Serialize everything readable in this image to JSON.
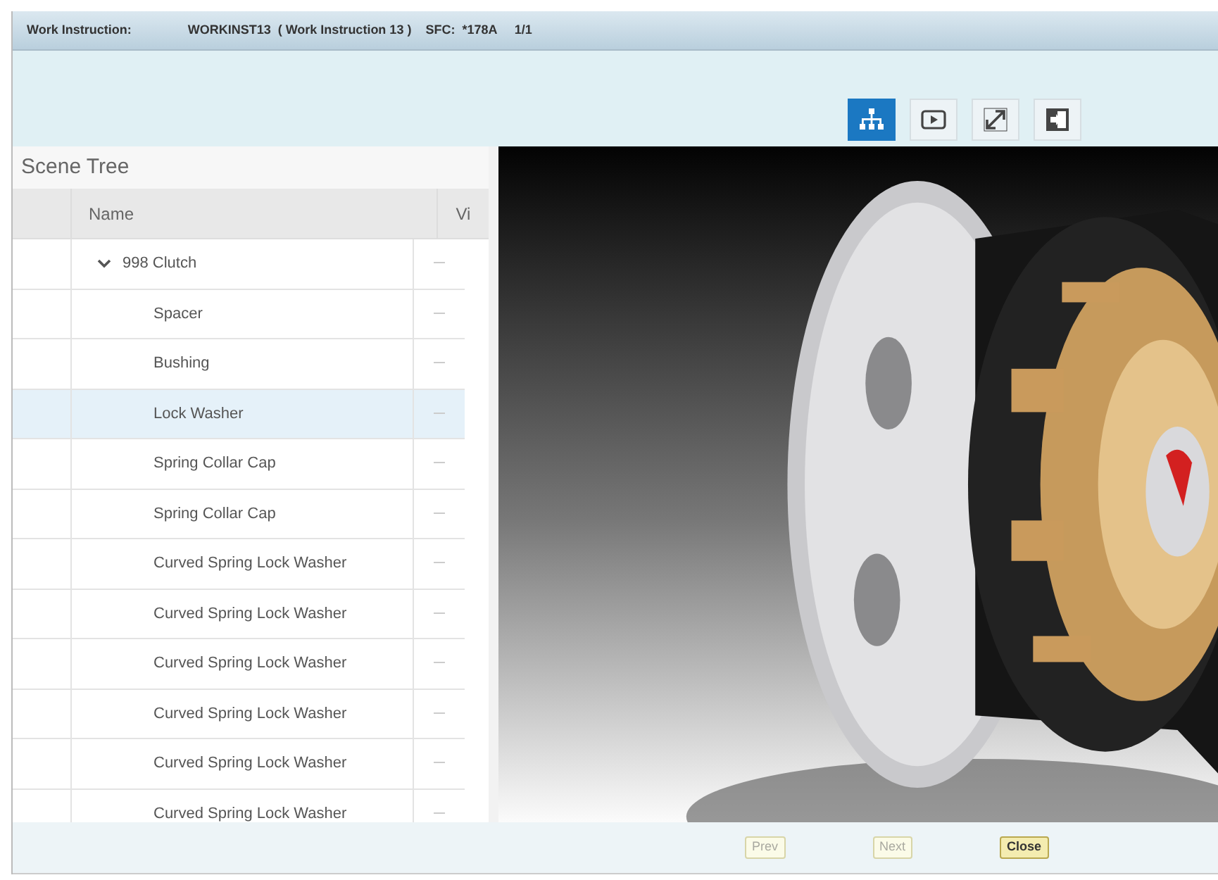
{
  "header": {
    "label": "Work Instruction:",
    "value": "WORKINST13  ( Work Instruction 13 )    SFC:  *178A     1/1"
  },
  "toolbar": [
    {
      "kind": "tree",
      "selected": true
    },
    {
      "kind": "play",
      "selected": false
    },
    {
      "kind": "expand",
      "selected": false
    },
    {
      "kind": "exit",
      "selected": false
    }
  ],
  "scene_tree": {
    "title": "Scene Tree",
    "columns": [
      "Name",
      "Vi"
    ],
    "root": {
      "name": "998 Clutch",
      "expanded": true,
      "selected": false,
      "children": [
        {
          "name": "Spacer",
          "selected": false
        },
        {
          "name": "Bushing",
          "selected": false
        },
        {
          "name": "Lock Washer",
          "selected": true
        },
        {
          "name": "Spring Collar Cap",
          "selected": false
        },
        {
          "name": "Spring Collar Cap",
          "selected": false
        },
        {
          "name": "Curved Spring Lock Washer",
          "selected": false
        },
        {
          "name": "Curved Spring Lock Washer",
          "selected": false
        },
        {
          "name": "Curved Spring Lock Washer",
          "selected": false
        },
        {
          "name": "Curved Spring Lock Washer",
          "selected": false
        },
        {
          "name": "Curved Spring Lock Washer",
          "selected": false
        },
        {
          "name": "Curved Spring Lock Washer",
          "selected": false
        }
      ]
    }
  },
  "footer_buttons": [
    {
      "label": "Prev",
      "disabled": true
    },
    {
      "label": "Next",
      "disabled": true
    },
    {
      "label": "Close",
      "disabled": false
    }
  ]
}
